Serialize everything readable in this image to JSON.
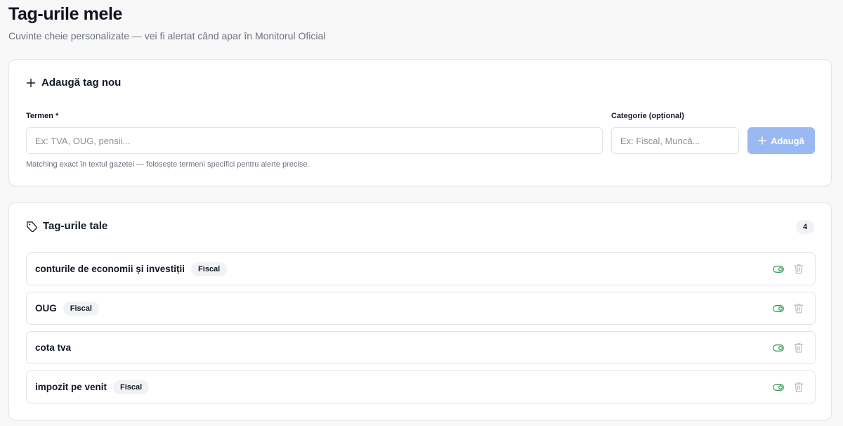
{
  "page": {
    "title": "Tag-urile mele",
    "subtitle": "Cuvinte cheie personalizate — vei fi alertat când apar în Monitorul Oficial"
  },
  "add_card": {
    "title": "Adaugă tag nou",
    "term_label": "Termen *",
    "term_placeholder": "Ex: TVA, OUG, pensii...",
    "term_value": "",
    "category_label": "Categorie (opțional)",
    "category_placeholder": "Ex: Fiscal, Muncă...",
    "category_value": "",
    "add_button_label": "Adaugă",
    "hint": "Matching exact în textul gazetei — folosește termeni specifici pentru alerte precise."
  },
  "list_card": {
    "title": "Tag-urile tale",
    "count": "4",
    "tags": [
      {
        "term": "conturile de economii și investiții",
        "category": "Fiscal",
        "active": true
      },
      {
        "term": "OUG",
        "category": "Fiscal",
        "active": true
      },
      {
        "term": "cota tva",
        "category": "",
        "active": true
      },
      {
        "term": "impozit pe venit",
        "category": "Fiscal",
        "active": true
      }
    ]
  },
  "colors": {
    "accent_disabled": "#9ab9f2",
    "toggle_on": "#3f9f5e",
    "trash_icon": "#b9bcc2"
  },
  "icons": {
    "add_card_icon": "plus-icon",
    "add_button_icon": "plus-icon",
    "list_card_icon": "tag-icon",
    "row_toggle_icon": "toggle-on-icon",
    "row_delete_icon": "trash-icon"
  }
}
